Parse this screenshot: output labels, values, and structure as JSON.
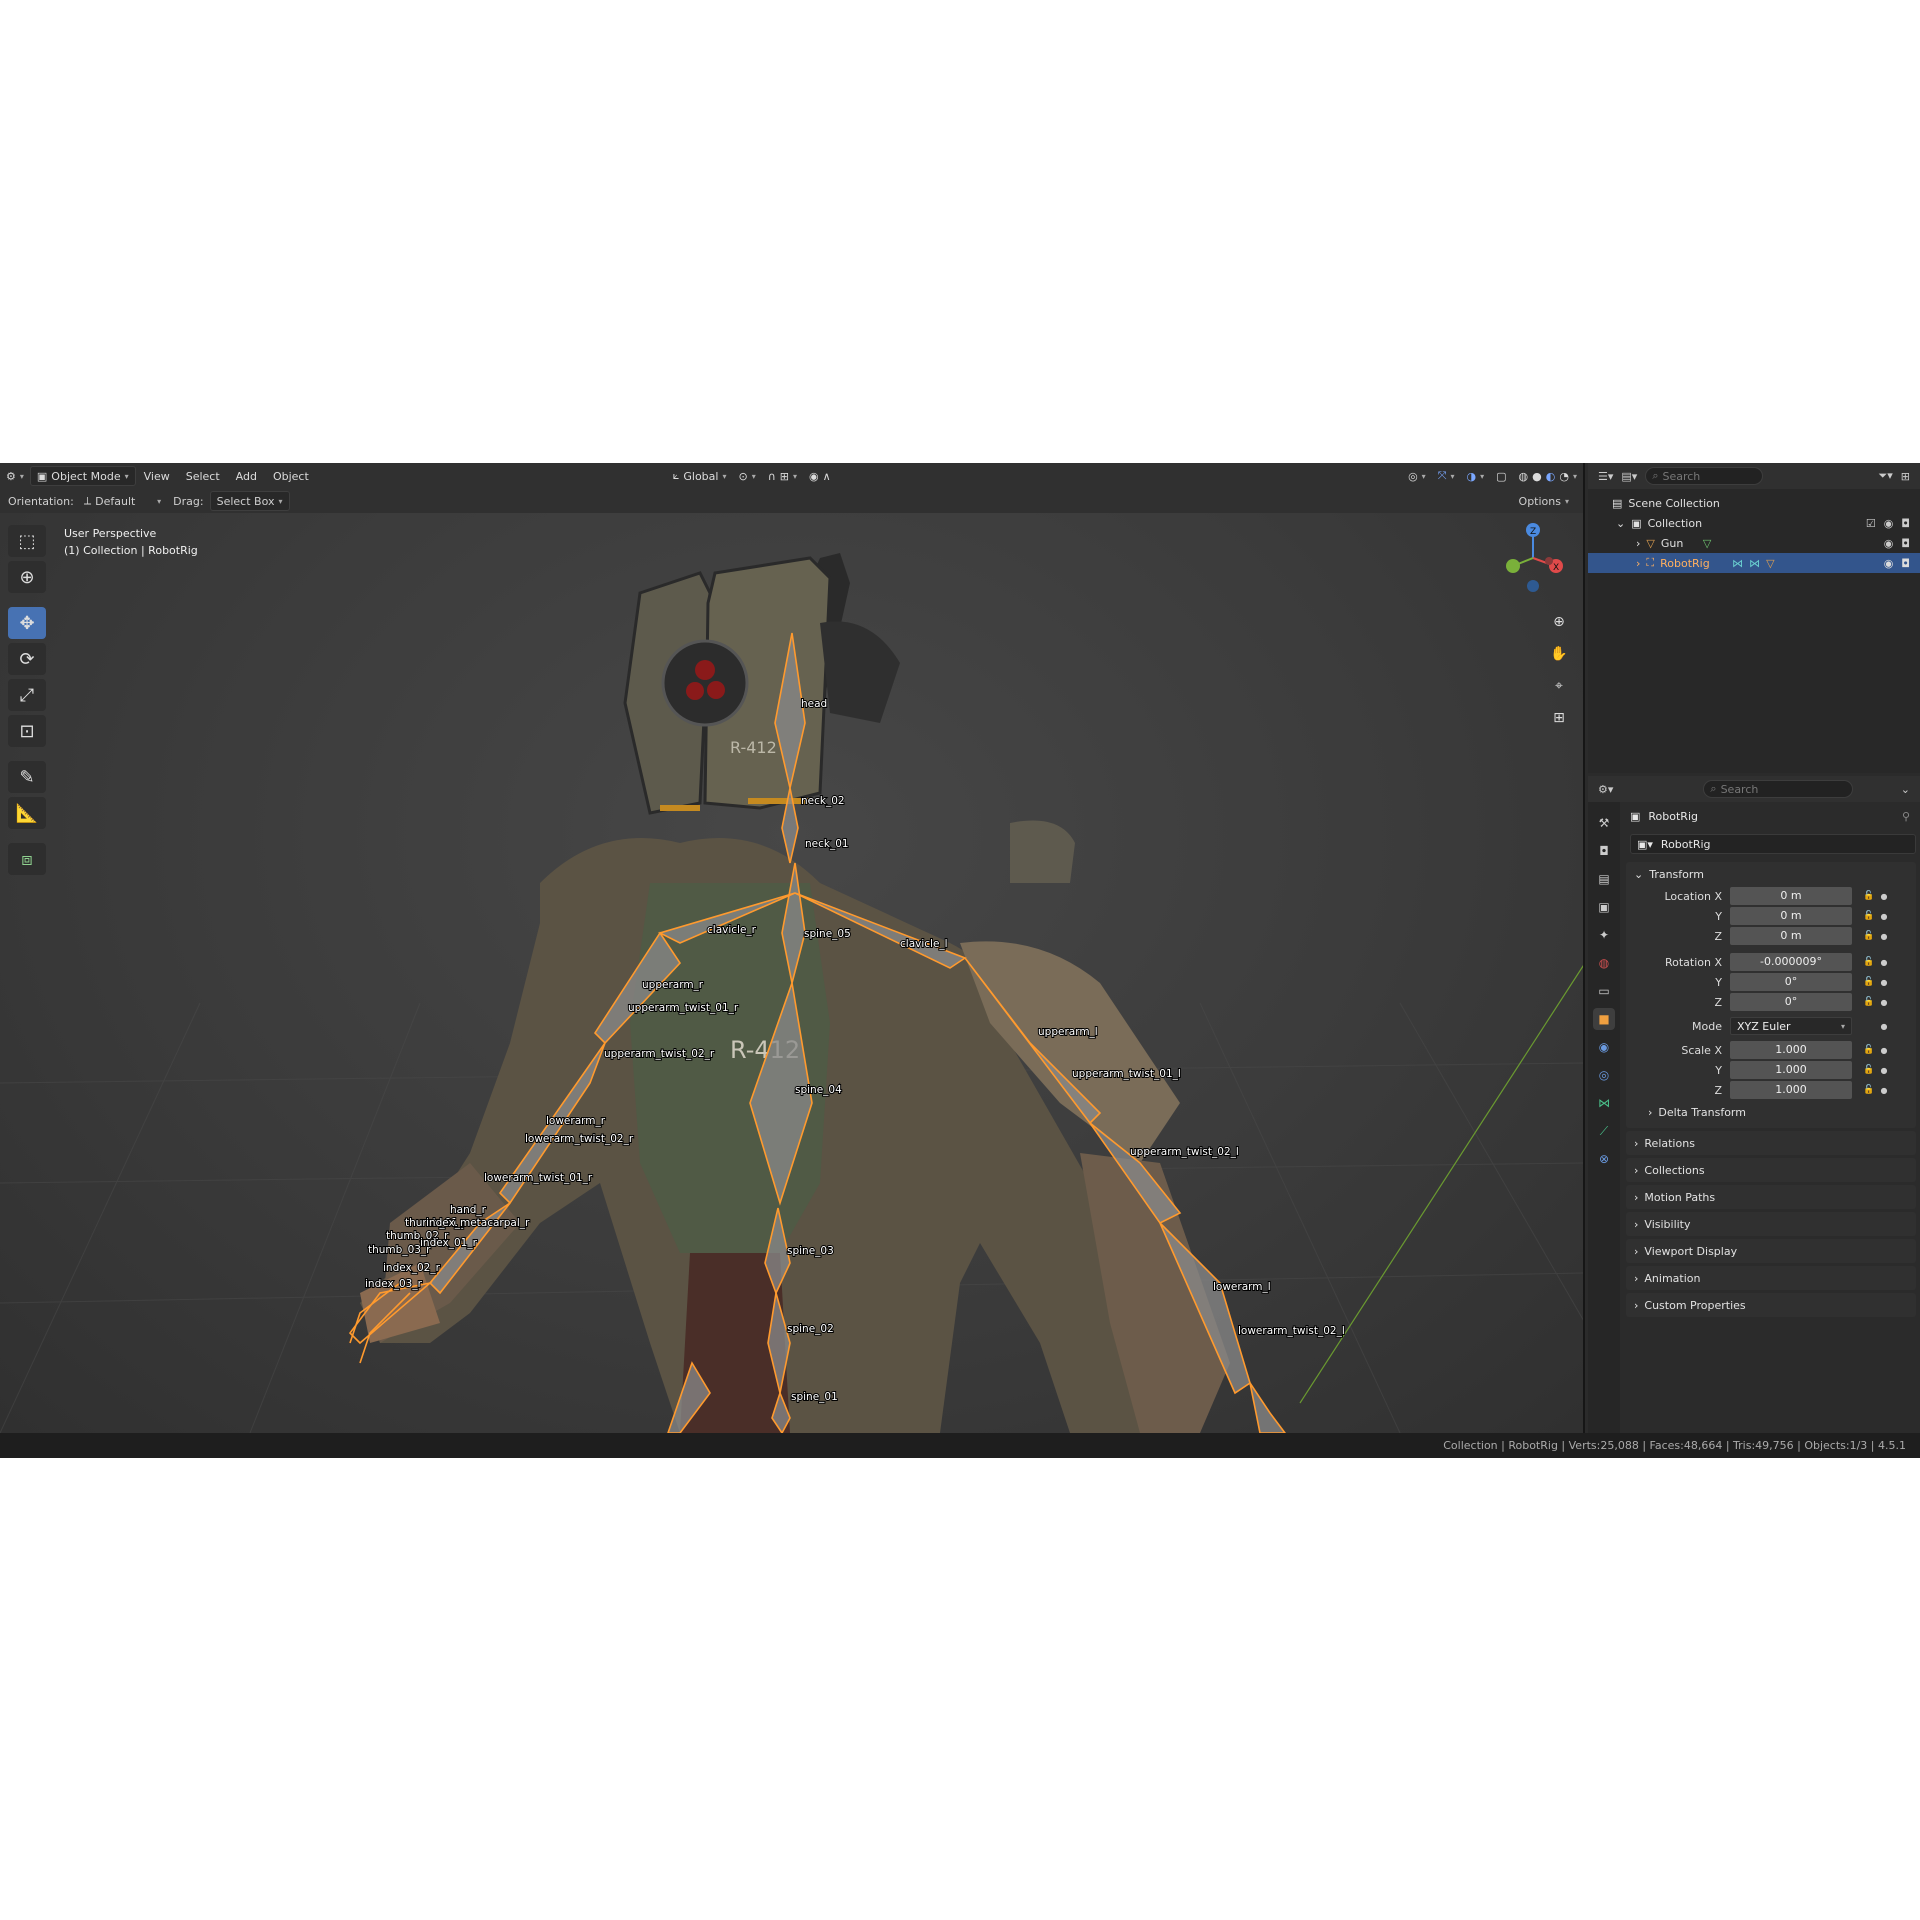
{
  "header": {
    "mode": "Object Mode",
    "menus": [
      "View",
      "Select",
      "Add",
      "Object"
    ],
    "transform_orientation": "Global"
  },
  "subheader": {
    "orientation_label": "Orientation:",
    "orientation_value": "Default",
    "drag_label": "Drag:",
    "drag_value": "Select Box",
    "options": "Options"
  },
  "viewport_info": {
    "line1": "User Perspective",
    "line2": "(1) Collection | RobotRig"
  },
  "gizmo": {
    "z": "Z",
    "x": "X"
  },
  "bones": [
    "head",
    "neck_02",
    "neck_01",
    "clavicle_r",
    "spine_05",
    "clavicle_l",
    "upperarm_r",
    "upperarm_twist_01_r",
    "upperarm_twist_02_r",
    "upperarm_l",
    "upperarm_twist_01_l",
    "spine_04",
    "lowerarm_r",
    "lowerarm_twist_02_r",
    "lowerarm_twist_01_r",
    "hand_r",
    "upperarm_twist_02_l",
    "spine_03",
    "lowerarm_l",
    "spine_02",
    "lowerarm_twist_02_l",
    "spine_01",
    "thumb_02_r",
    "thumb_03_r",
    "index_02_r",
    "index_03_r",
    "index_01_r",
    "thumb_01_r",
    "index_metacarpal_r"
  ],
  "decal": {
    "head": "R-412",
    "chest": "R-412"
  },
  "outliner": {
    "search_placeholder": "Search",
    "scene": "Scene Collection",
    "collection": "Collection",
    "items": [
      {
        "name": "Gun"
      },
      {
        "name": "RobotRig"
      }
    ]
  },
  "properties": {
    "search_placeholder": "Search",
    "object_name": "RobotRig",
    "name_field": "RobotRig",
    "transform": {
      "title": "Transform",
      "location": {
        "label": "Location X",
        "x": "0 m",
        "y": "0 m",
        "z": "0 m"
      },
      "rotation": {
        "label": "Rotation X",
        "x": "-0.000009°",
        "y": "0°",
        "z": "0°"
      },
      "mode": {
        "label": "Mode",
        "value": "XYZ Euler"
      },
      "scale": {
        "label": "Scale X",
        "x": "1.000",
        "y": "1.000",
        "z": "1.000"
      },
      "y_label": "Y",
      "z_label": "Z",
      "delta": "Delta Transform"
    },
    "panels": [
      "Relations",
      "Collections",
      "Motion Paths",
      "Visibility",
      "Viewport Display",
      "Animation",
      "Custom Properties"
    ]
  },
  "status": "Collection | RobotRig | Verts:25,088 | Faces:48,664 | Tris:49,756 | Objects:1/3 | 4.5.1",
  "colors": {
    "accent": "#4772b3",
    "selected_text": "#ffb060",
    "bone_outline": "#ff9a2e"
  }
}
